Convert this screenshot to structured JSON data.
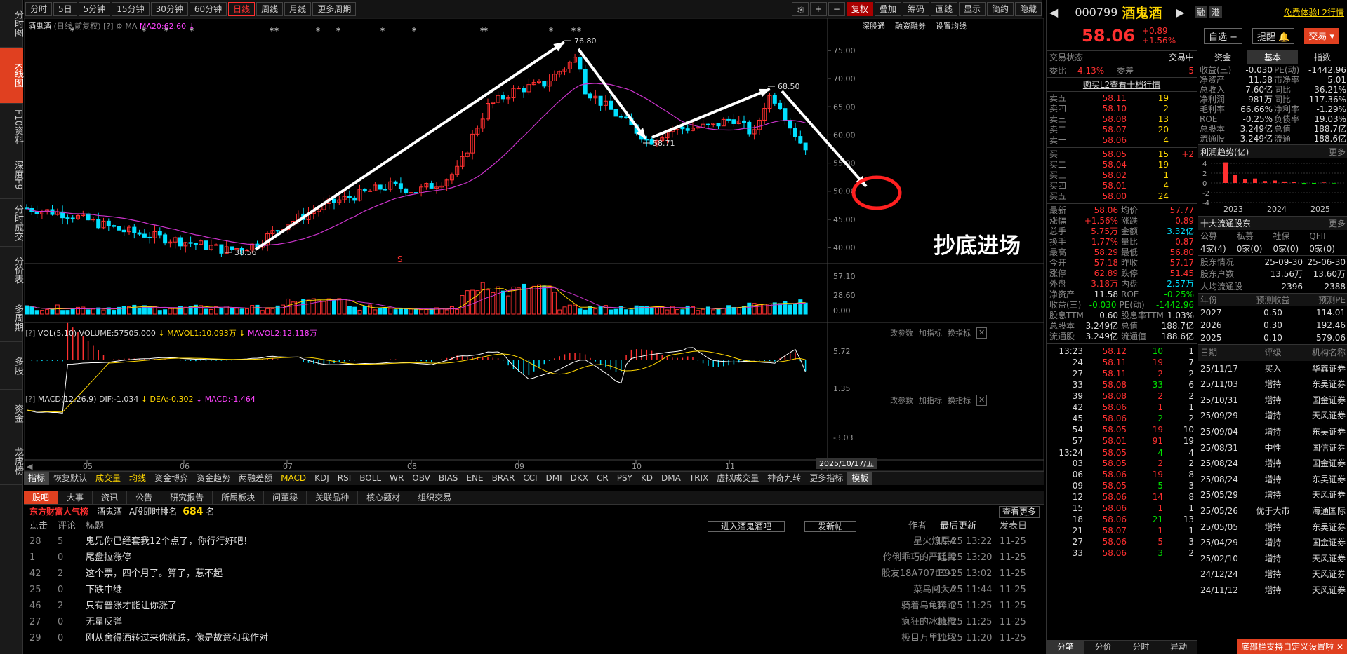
{
  "leftnav": [
    "分时图",
    "K线图",
    "F10资料",
    "深度F9",
    "分时成交",
    "分价表",
    "多周期",
    "多股",
    "资金",
    "龙虎榜"
  ],
  "toolbar": {
    "periods": [
      "分时",
      "5日",
      "5分钟",
      "15分钟",
      "30分钟",
      "60分钟",
      "日线",
      "周线",
      "月线",
      "更多周期"
    ],
    "right": [
      "复权",
      "叠加",
      "筹码",
      "画线",
      "显示",
      "简约",
      "隐藏"
    ]
  },
  "chart": {
    "name": "酒鬼酒",
    "mode": "(日线,前复权)",
    "ma_label": "MA",
    "ma20": "MA20:62.60",
    "links": [
      "深股通",
      "融资融券",
      "设置均线"
    ],
    "price_ticks": [
      "75.00",
      "70.00",
      "65.00",
      "60.00",
      "55.00",
      "50.00",
      "45.00",
      "40.00"
    ],
    "anno": {
      "high": "76.80",
      "low": "38.56",
      "mid_low": "58.71",
      "mid_high": "68.50",
      "callout": "抄底进场"
    },
    "vol_header": {
      "label": "VOL(5,10)",
      "volume": "VOLUME:57505.000",
      "mavol1": "MAVOL1:10.093万",
      "mavol2": "MAVOL2:12.118万"
    },
    "vol_ticks": [
      "57.10",
      "28.60",
      "0.00"
    ],
    "macd_header": {
      "label": "MACD(12,26,9)",
      "dif": "DIF:-1.034",
      "dea": "DEA:-0.302",
      "macd": "MACD:-1.464"
    },
    "macd_ticks": [
      "5.72",
      "1.35",
      "-3.03"
    ],
    "sub_links": [
      "改参数",
      "加指标",
      "换指标"
    ],
    "date_ticks": [
      "05",
      "06",
      "07",
      "08",
      "09",
      "10",
      "11"
    ],
    "date_box": "2025/10/17/五"
  },
  "indicators": [
    "指标",
    "恢复默认",
    "成交量",
    "均线",
    "资金博弈",
    "资金趋势",
    "两融差额",
    "MACD",
    "KDJ",
    "RSI",
    "BOLL",
    "WR",
    "OBV",
    "BIAS",
    "ENE",
    "BRAR",
    "CCI",
    "DMI",
    "DKX",
    "CR",
    "PSY",
    "KD",
    "DMA",
    "TRIX",
    "虚拟成交量",
    "神奇九转",
    "更多指标",
    "模板"
  ],
  "forum": {
    "tabs": [
      "股吧",
      "大事",
      "资讯",
      "公告",
      "研究报告",
      "所属板块",
      "问董秘",
      "关联品种",
      "核心题材",
      "组织交易"
    ],
    "rank_title": "东方财富人气榜",
    "rank_stock": "酒鬼酒",
    "rank_label": "A股即时排名",
    "rank_num": "684",
    "rank_unit": "名",
    "more": "查看更多",
    "enter_btn": "进入酒鬼酒吧",
    "post_btn": "发新帖",
    "cols": [
      "点击",
      "评论",
      "标题",
      "作者",
      "最后更新",
      "发表日"
    ],
    "rows": [
      [
        "28",
        "5",
        "鬼兄你已经套我12个点了，你行行好吧！",
        "星火燎原A",
        "11-25 13:22",
        "11-25"
      ],
      [
        "1",
        "0",
        "尾盘拉涨停",
        "伶俐乖巧的严廷菁",
        "11-25 13:20",
        "11-25"
      ],
      [
        "42",
        "2",
        "这个票，四个月了。算了，惹不起",
        "股友18A707t391",
        "11-25 13:02",
        "11-25"
      ],
      [
        "25",
        "0",
        "下跌中继",
        "菜鸟闯大A",
        "11-25 11:44",
        "11-25"
      ],
      [
        "46",
        "2",
        "只有普涨才能让你涨了",
        "骑着乌龟奔跑",
        "11-25 11:25",
        "11-25"
      ],
      [
        "27",
        "0",
        "无量反弹",
        "疯狂的冰糖橙",
        "11-25 11:25",
        "11-25"
      ],
      [
        "29",
        "0",
        "刚从舍得酒转过来你就跌，像是故意和我作对",
        "极目万里沙场",
        "11-25 11:20",
        "11-25"
      ]
    ]
  },
  "quote": {
    "code": "000799",
    "name": "酒鬼酒",
    "tags": [
      "融",
      "港"
    ],
    "promo": "免费体验L2行情",
    "price": "58.06",
    "change": "+0.89",
    "pct": "+1.56%",
    "btns": [
      "自选",
      "提醒",
      "交易"
    ],
    "status_label": "交易状态",
    "status": "交易中",
    "weibi_label": "委比",
    "weibi": "4.13%",
    "weicha_label": "委差",
    "weicha": "5",
    "l2link": "购买L2查看十档行情",
    "sells": [
      [
        "卖五",
        "58.11",
        "19"
      ],
      [
        "卖四",
        "58.10",
        "2"
      ],
      [
        "卖三",
        "58.08",
        "13"
      ],
      [
        "卖二",
        "58.07",
        "20"
      ],
      [
        "卖一",
        "58.06",
        "4"
      ]
    ],
    "buys": [
      [
        "买一",
        "58.05",
        "15",
        "+2"
      ],
      [
        "买二",
        "58.04",
        "19",
        ""
      ],
      [
        "买三",
        "58.02",
        "1",
        ""
      ],
      [
        "买四",
        "58.01",
        "4",
        ""
      ],
      [
        "买五",
        "58.00",
        "24",
        ""
      ]
    ],
    "stats": [
      [
        "最新",
        "58.06",
        "均价",
        "57.77"
      ],
      [
        "涨幅",
        "+1.56%",
        "涨跌",
        "0.89"
      ],
      [
        "总手",
        "5.75万",
        "金额",
        "3.32亿"
      ],
      [
        "换手",
        "1.77%",
        "量比",
        "0.87"
      ],
      [
        "最高",
        "58.29",
        "最低",
        "56.80"
      ],
      [
        "今开",
        "57.18",
        "昨收",
        "57.17"
      ],
      [
        "涨停",
        "62.89",
        "跌停",
        "51.45"
      ],
      [
        "外盘",
        "3.18万",
        "内盘",
        "2.57万"
      ],
      [
        "净资产",
        "11.58",
        "ROE",
        "-0.25%"
      ],
      [
        "收益(三)",
        "-0.030",
        "PE(动)",
        "-1442.96"
      ],
      [
        "股息TTM",
        "0.60",
        "股息率TTM",
        "1.03%"
      ],
      [
        "总股本",
        "3.249亿",
        "总值",
        "188.7亿"
      ],
      [
        "流通股",
        "3.249亿",
        "流通值",
        "188.6亿"
      ]
    ],
    "ticks": [
      [
        "13:23",
        "58.12",
        "10",
        "1"
      ],
      [
        "24",
        "58.11",
        "19",
        "7"
      ],
      [
        "27",
        "58.11",
        "2",
        "2"
      ],
      [
        "33",
        "58.08",
        "33",
        "6"
      ],
      [
        "39",
        "58.08",
        "2",
        "2"
      ],
      [
        "42",
        "58.06",
        "1",
        "1"
      ],
      [
        "45",
        "58.06",
        "2",
        "2"
      ],
      [
        "54",
        "58.05",
        "19",
        "10"
      ],
      [
        "57",
        "58.01",
        "91",
        "19"
      ],
      [
        "13:24",
        "58.05",
        "4",
        "4"
      ],
      [
        "03",
        "58.05",
        "2",
        "2"
      ],
      [
        "06",
        "58.06",
        "19",
        "8"
      ],
      [
        "09",
        "58.05",
        "5",
        "3"
      ],
      [
        "12",
        "58.06",
        "14",
        "8"
      ],
      [
        "15",
        "58.06",
        "1",
        "1"
      ],
      [
        "18",
        "58.06",
        "21",
        "13"
      ],
      [
        "21",
        "58.07",
        "1",
        "1"
      ],
      [
        "27",
        "58.06",
        "5",
        "3"
      ],
      [
        "33",
        "58.06",
        "3",
        "2"
      ]
    ],
    "bottom_tabs": [
      "分笔",
      "分价",
      "分时",
      "异动"
    ]
  },
  "fund": {
    "tabs": [
      "资金",
      "基本",
      "指数"
    ],
    "rows": [
      [
        "收益(三)",
        "-0.030",
        "PE(动)",
        "-1442.96"
      ],
      [
        "净资产",
        "11.58",
        "市净率",
        "5.01"
      ],
      [
        "总收入",
        "7.60亿",
        "同比",
        "-36.21%"
      ],
      [
        "净利润",
        "-981万",
        "同比",
        "-117.36%"
      ],
      [
        "毛利率",
        "66.66%",
        "净利率",
        "-1.29%"
      ],
      [
        "ROE",
        "-0.25%",
        "负债率",
        "19.03%"
      ],
      [
        "总股本",
        "3.249亿",
        "总值",
        "188.7亿"
      ],
      [
        "流通股",
        "3.249亿",
        "流通",
        "188.6亿"
      ]
    ],
    "trend_title": "利润趋势(亿)",
    "more": "更多",
    "trend_ticks": [
      "4",
      "2",
      "0",
      "-2",
      "-4"
    ],
    "trend_years": [
      "2023",
      "2024",
      "2025"
    ],
    "holders_title": "十大流通股东",
    "holder_cols": [
      "公募",
      "私募",
      "社保",
      "QFII"
    ],
    "holder_vals": [
      "4家(4)",
      "0家(0)",
      "0家(0)",
      "0家(0)"
    ],
    "holder_rows": [
      [
        "股东情况",
        "25-09-30",
        "25-06-30"
      ],
      [
        "股东户数",
        "13.56万",
        "13.60万"
      ],
      [
        "人均流通股",
        "2396",
        "2388"
      ]
    ],
    "forecast_cols": [
      "年份",
      "预测收益",
      "预测PE"
    ],
    "forecast": [
      [
        "2027",
        "0.50",
        "114.01"
      ],
      [
        "2026",
        "0.30",
        "192.46"
      ],
      [
        "2025",
        "0.10",
        "579.06"
      ]
    ],
    "rating_cols": [
      "日期",
      "评级",
      "机构名称"
    ],
    "ratings": [
      [
        "25/11/17",
        "买入",
        "华鑫证券"
      ],
      [
        "25/11/03",
        "增持",
        "东吴证券"
      ],
      [
        "25/10/31",
        "增持",
        "国金证券"
      ],
      [
        "25/09/29",
        "增持",
        "天风证券"
      ],
      [
        "25/09/04",
        "增持",
        "东吴证券"
      ],
      [
        "25/08/31",
        "中性",
        "国信证券"
      ],
      [
        "25/08/24",
        "增持",
        "国金证券"
      ],
      [
        "25/08/24",
        "增持",
        "东吴证券"
      ],
      [
        "25/05/29",
        "增持",
        "天风证券"
      ],
      [
        "25/05/26",
        "优于大市",
        "海通国际"
      ],
      [
        "25/05/05",
        "增持",
        "东吴证券"
      ],
      [
        "25/04/29",
        "增持",
        "国金证券"
      ],
      [
        "25/02/10",
        "增持",
        "天风证券"
      ],
      [
        "24/12/24",
        "增持",
        "天风证券"
      ],
      [
        "24/11/12",
        "增持",
        "天风证券"
      ]
    ],
    "footer_tip": "底部栏支持自定义设置啦"
  }
}
